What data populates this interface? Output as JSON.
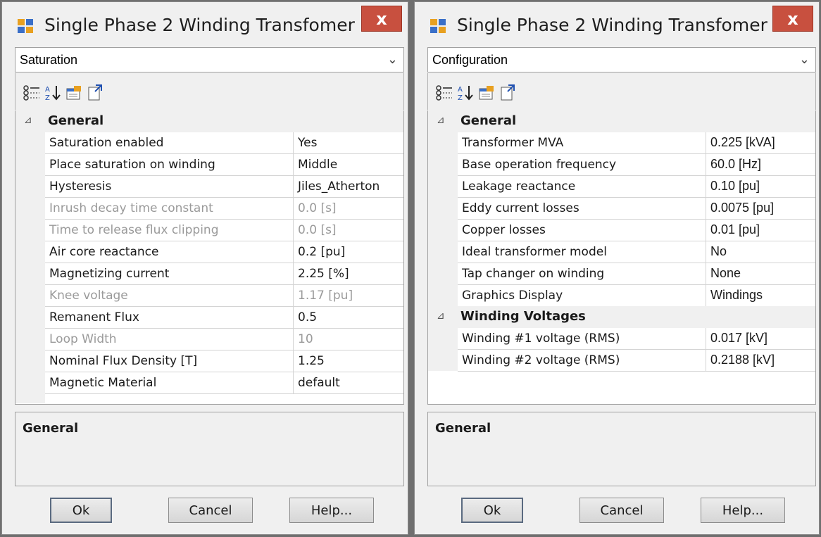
{
  "left": {
    "title": "Single Phase 2 Winding Transfomer",
    "close_label": "x",
    "selector_value": "Saturation",
    "category": "General",
    "rows": [
      {
        "name": "Saturation enabled",
        "value": "Yes",
        "disabled": false
      },
      {
        "name": "Place saturation on winding",
        "value": "Middle",
        "disabled": false
      },
      {
        "name": "Hysteresis",
        "value": "Jiles_Atherton",
        "disabled": false
      },
      {
        "name": "Inrush decay time constant",
        "value": "0.0 [s]",
        "disabled": true
      },
      {
        "name": "Time to release flux clipping",
        "value": "0.0 [s]",
        "disabled": true
      },
      {
        "name": "Air core reactance",
        "value": "0.2 [pu]",
        "disabled": false
      },
      {
        "name": "Magnetizing current",
        "value": "2.25 [%]",
        "disabled": false
      },
      {
        "name": "Knee voltage",
        "value": "1.17 [pu]",
        "disabled": true
      },
      {
        "name": "Remanent Flux",
        "value": "0.5",
        "disabled": false
      },
      {
        "name": "Loop Width",
        "value": "10",
        "disabled": true
      },
      {
        "name": "Nominal Flux Density [T]",
        "value": "1.25",
        "disabled": false
      },
      {
        "name": "Magnetic Material",
        "value": "default",
        "disabled": false
      }
    ],
    "description_title": "General",
    "buttons": {
      "ok": "Ok",
      "cancel": "Cancel",
      "help": "Help..."
    }
  },
  "right": {
    "title": "Single Phase 2 Winding Transfomer",
    "close_label": "x",
    "selector_value": "Configuration",
    "category": "General",
    "rows": [
      {
        "name": "Transformer MVA",
        "value": "0.225 [kVA]",
        "disabled": false
      },
      {
        "name": "Base operation frequency",
        "value": "60.0 [Hz]",
        "disabled": false
      },
      {
        "name": "Leakage reactance",
        "value": "0.10 [pu]",
        "disabled": false
      },
      {
        "name": "Eddy current losses",
        "value": "0.0075 [pu]",
        "disabled": false
      },
      {
        "name": "Copper losses",
        "value": "0.01 [pu]",
        "disabled": false
      },
      {
        "name": "Ideal transformer model",
        "value": "No",
        "disabled": false
      },
      {
        "name": "Tap changer on winding",
        "value": "None",
        "disabled": false
      },
      {
        "name": "Graphics Display",
        "value": "Windings",
        "disabled": false
      }
    ],
    "category2": "Winding Voltages",
    "rows2": [
      {
        "name": "Winding #1 voltage (RMS)",
        "value": "0.017 [kV]",
        "disabled": false
      },
      {
        "name": "Winding #2 voltage (RMS)",
        "value": "0.2188 [kV]",
        "disabled": false
      }
    ],
    "description_title": "General",
    "buttons": {
      "ok": "Ok",
      "cancel": "Cancel",
      "help": "Help..."
    }
  },
  "icons": {
    "app": "transformer-app-icon",
    "categorized": "categorized-view-icon",
    "alphabetical": "sort-alphabetical-icon",
    "property_pages": "property-pages-icon",
    "export": "export-page-icon"
  }
}
